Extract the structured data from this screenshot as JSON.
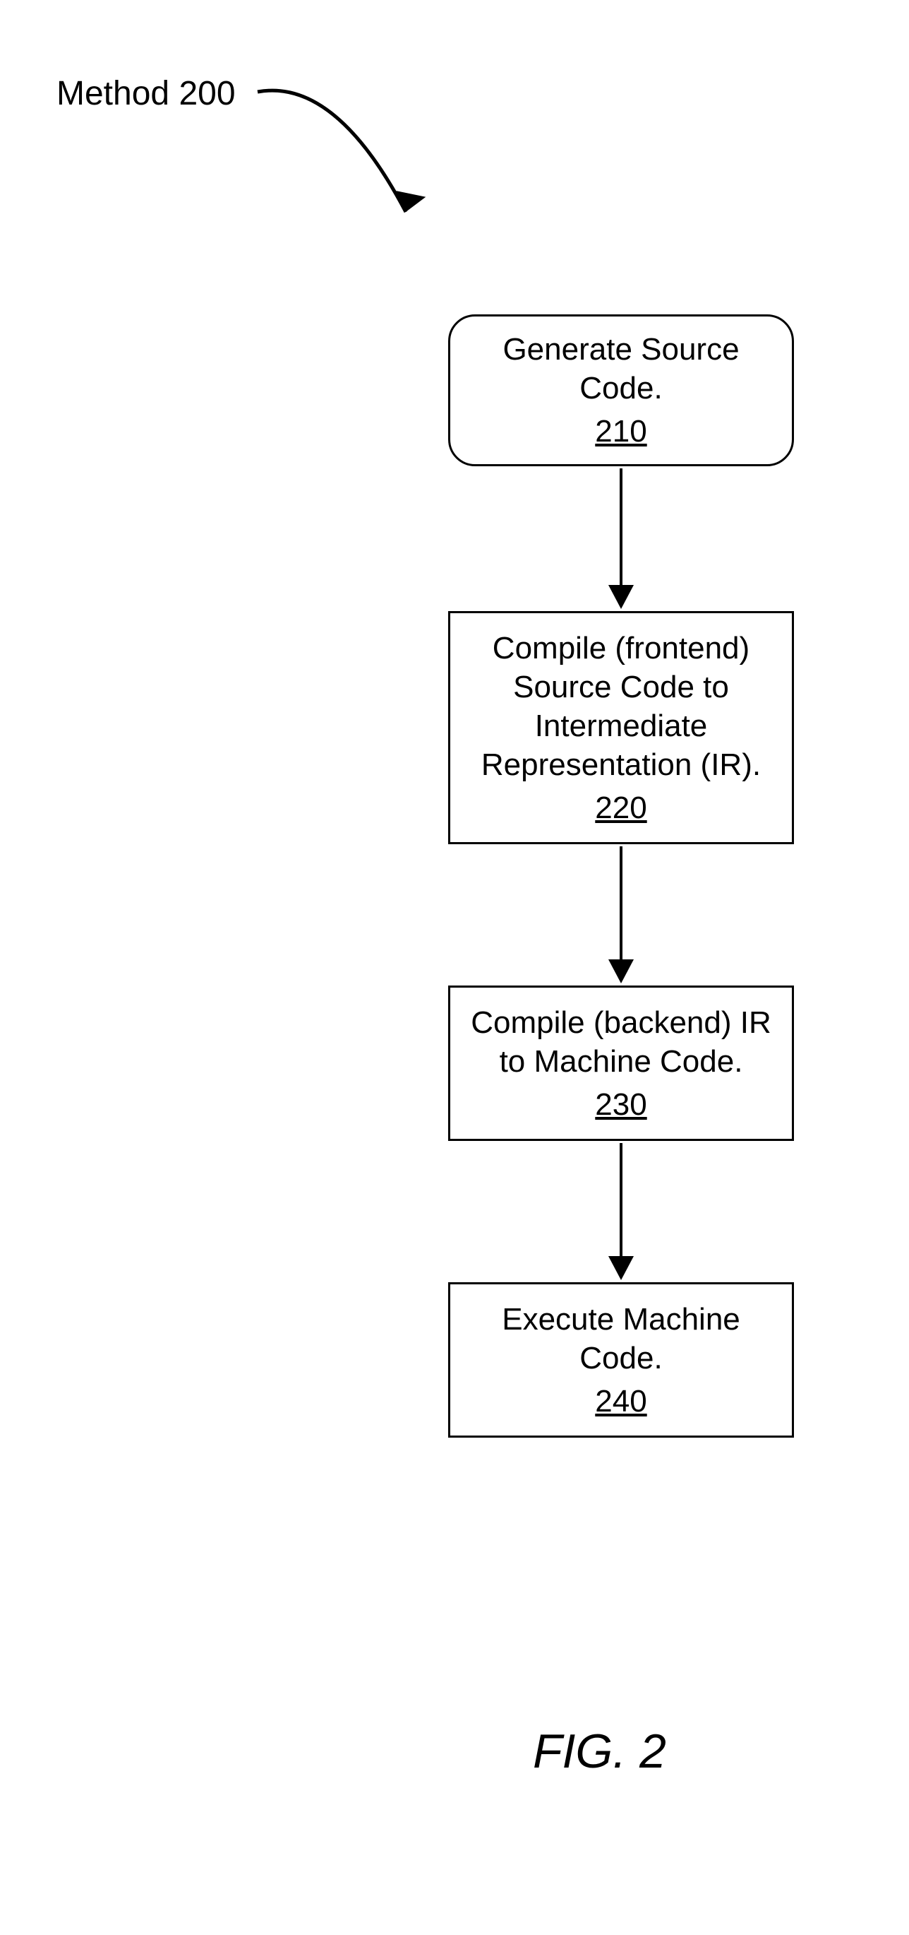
{
  "label": {
    "text": "Method 200"
  },
  "boxes": {
    "step1": {
      "text": "Generate Source\nCode.",
      "num": "210"
    },
    "step2": {
      "text": "Compile (frontend)\nSource Code to\nIntermediate\nRepresentation (IR).",
      "num": "220"
    },
    "step3": {
      "text": "Compile (backend) IR\nto Machine Code.",
      "num": "230"
    },
    "step4": {
      "text": "Execute Machine\nCode.",
      "num": "240"
    }
  },
  "caption": "FIG. 2"
}
